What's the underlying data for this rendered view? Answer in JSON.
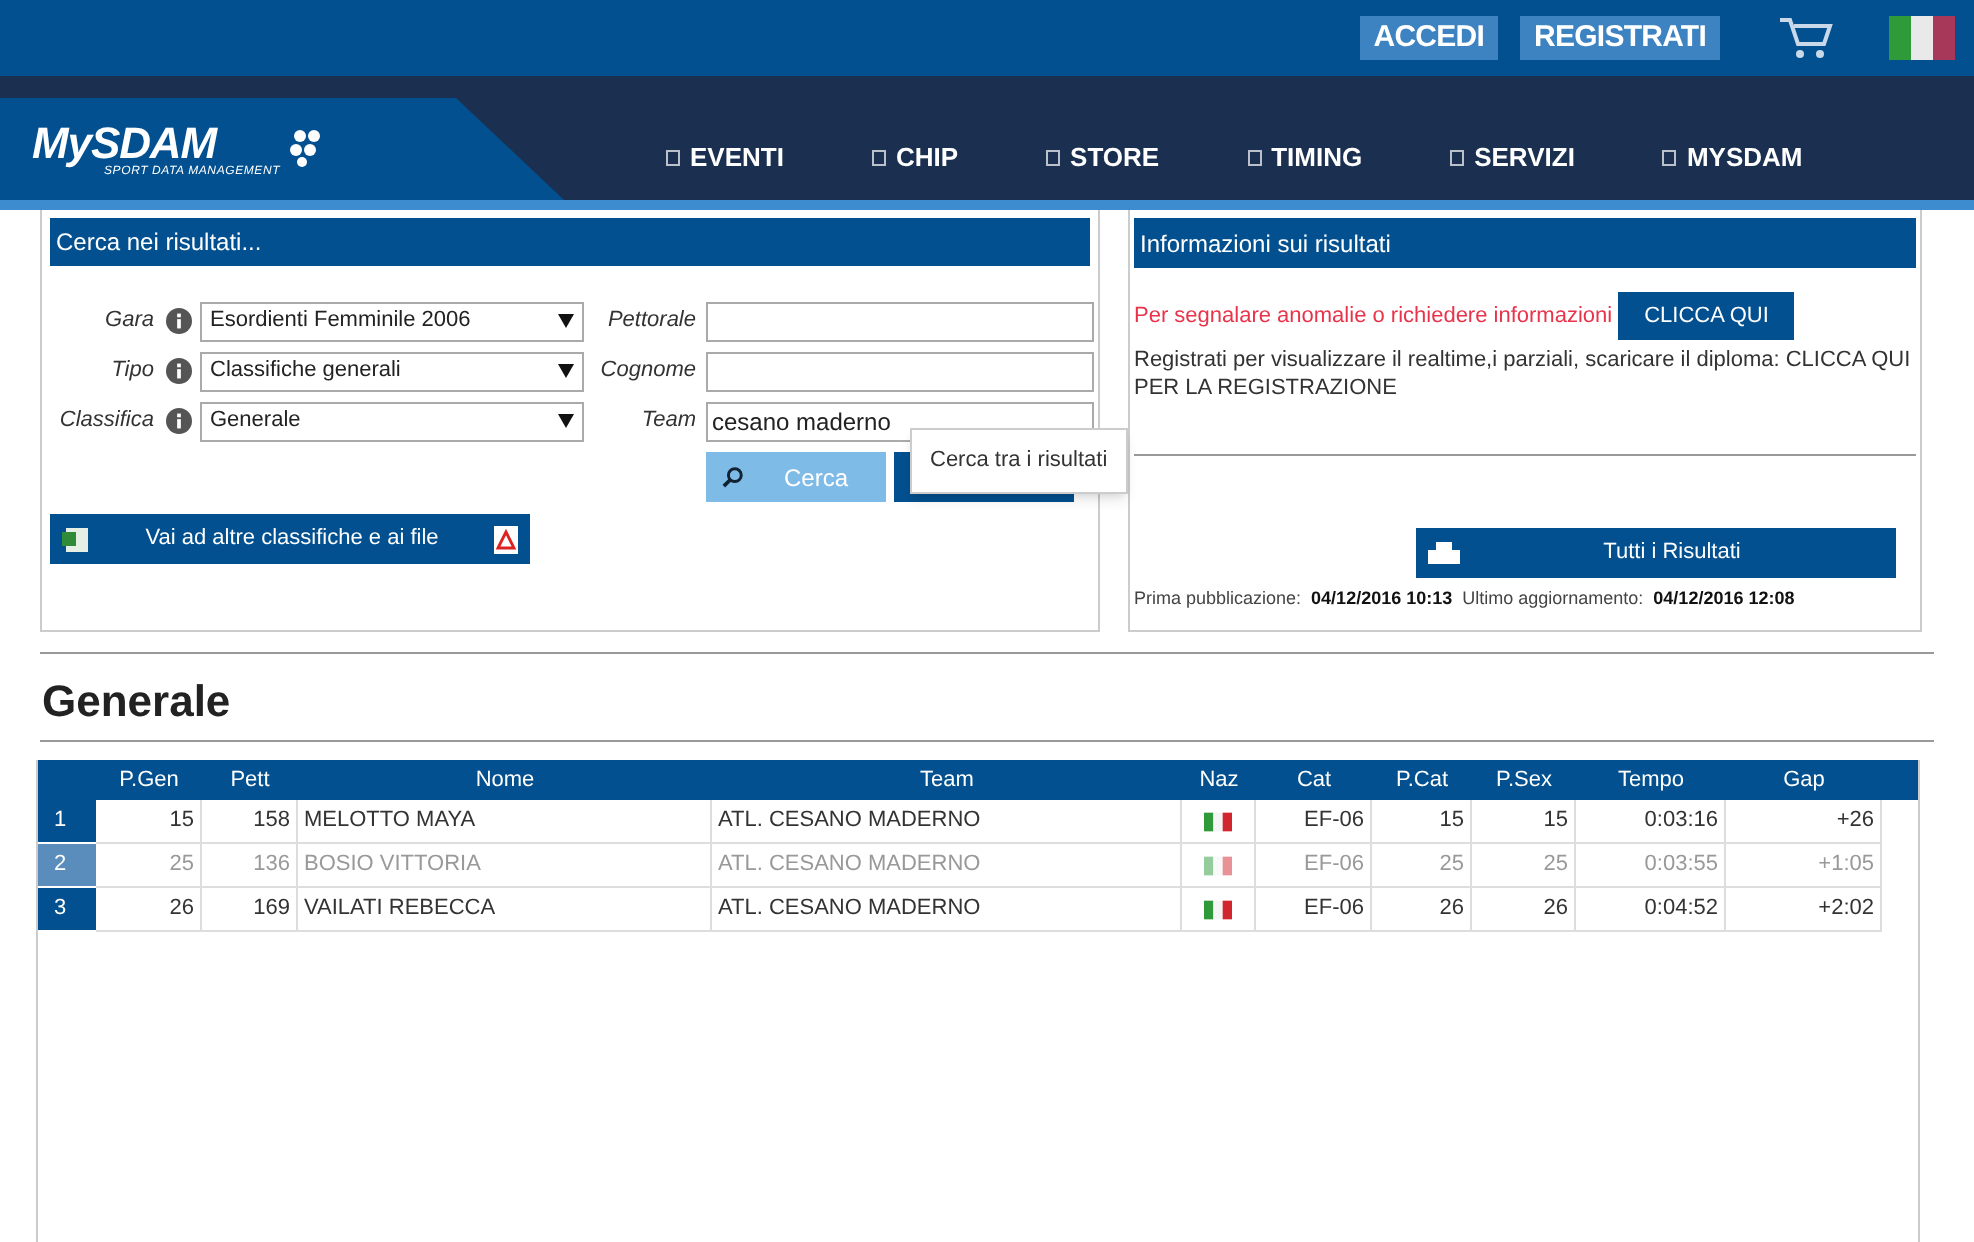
{
  "top_bar": {
    "buttons": [
      "ACCEDI",
      "REGISTRATI"
    ]
  },
  "logo": {
    "name": "MySDAM",
    "tagline": "SPORT DATA MANAGEMENT"
  },
  "nav": [
    "EVENTI",
    "CHIP",
    "STORE",
    "TIMING",
    "SERVIZI",
    "MYSDAM"
  ],
  "search_panel": {
    "title": "Cerca nei risultati...",
    "selects": [
      {
        "label": "Gara",
        "value": "Esordienti Femminile 2006"
      },
      {
        "label": "Tipo",
        "value": "Classifiche generali"
      },
      {
        "label": "Classifica",
        "value": "Generale"
      }
    ],
    "fields": [
      {
        "label": "Pettorale"
      },
      {
        "label": "Cognome"
      },
      {
        "label": "Team",
        "value": "cesano maderno"
      }
    ],
    "search_button": "Cerca",
    "tooltip": "Cerca tra i risultati",
    "files_button": "Vai ad altre classifiche e ai file"
  },
  "info_panel": {
    "title": "Informazioni sui risultati",
    "report_text": "Per segnalare anomalie o richiedere informazioni",
    "report_button": "CLICCA QUI",
    "register_text": "Registrati per visualizzare il realtime,i parziali, scaricare il diploma: CLICCA QUI PER LA REGISTRAZIONE",
    "all_results_button": "Tutti i Risultati",
    "first_pub_label": "Prima pubblicazione:",
    "first_pub": "04/12/2016 10:13",
    "last_update_label": "Ultimo aggiornamento:",
    "last_update": "04/12/2016 12:08"
  },
  "heading": "Generale",
  "table": {
    "columns": [
      "P.Gen",
      "Pett",
      "Nome",
      "Team",
      "Naz",
      "Cat",
      "P.Cat",
      "P.Sex",
      "Tempo",
      "Gap"
    ],
    "rows": [
      {
        "index": "1",
        "dimmed": false,
        "cells": [
          "15",
          "158",
          "MELOTTO MAYA",
          "ATL. CESANO MADERNO",
          null,
          "EF-06",
          "15",
          "15",
          "0:03:16",
          "+26"
        ]
      },
      {
        "index": "2",
        "dimmed": true,
        "cells": [
          "25",
          "136",
          "BOSIO VITTORIA",
          "ATL. CESANO MADERNO",
          null,
          "EF-06",
          "25",
          "25",
          "0:03:55",
          "+1:05"
        ]
      },
      {
        "index": "3",
        "dimmed": false,
        "cells": [
          "26",
          "169",
          "VAILATI REBECCA",
          "ATL. CESANO MADERNO",
          null,
          "EF-06",
          "26",
          "26",
          "0:04:52",
          "+2:02"
        ]
      }
    ]
  }
}
